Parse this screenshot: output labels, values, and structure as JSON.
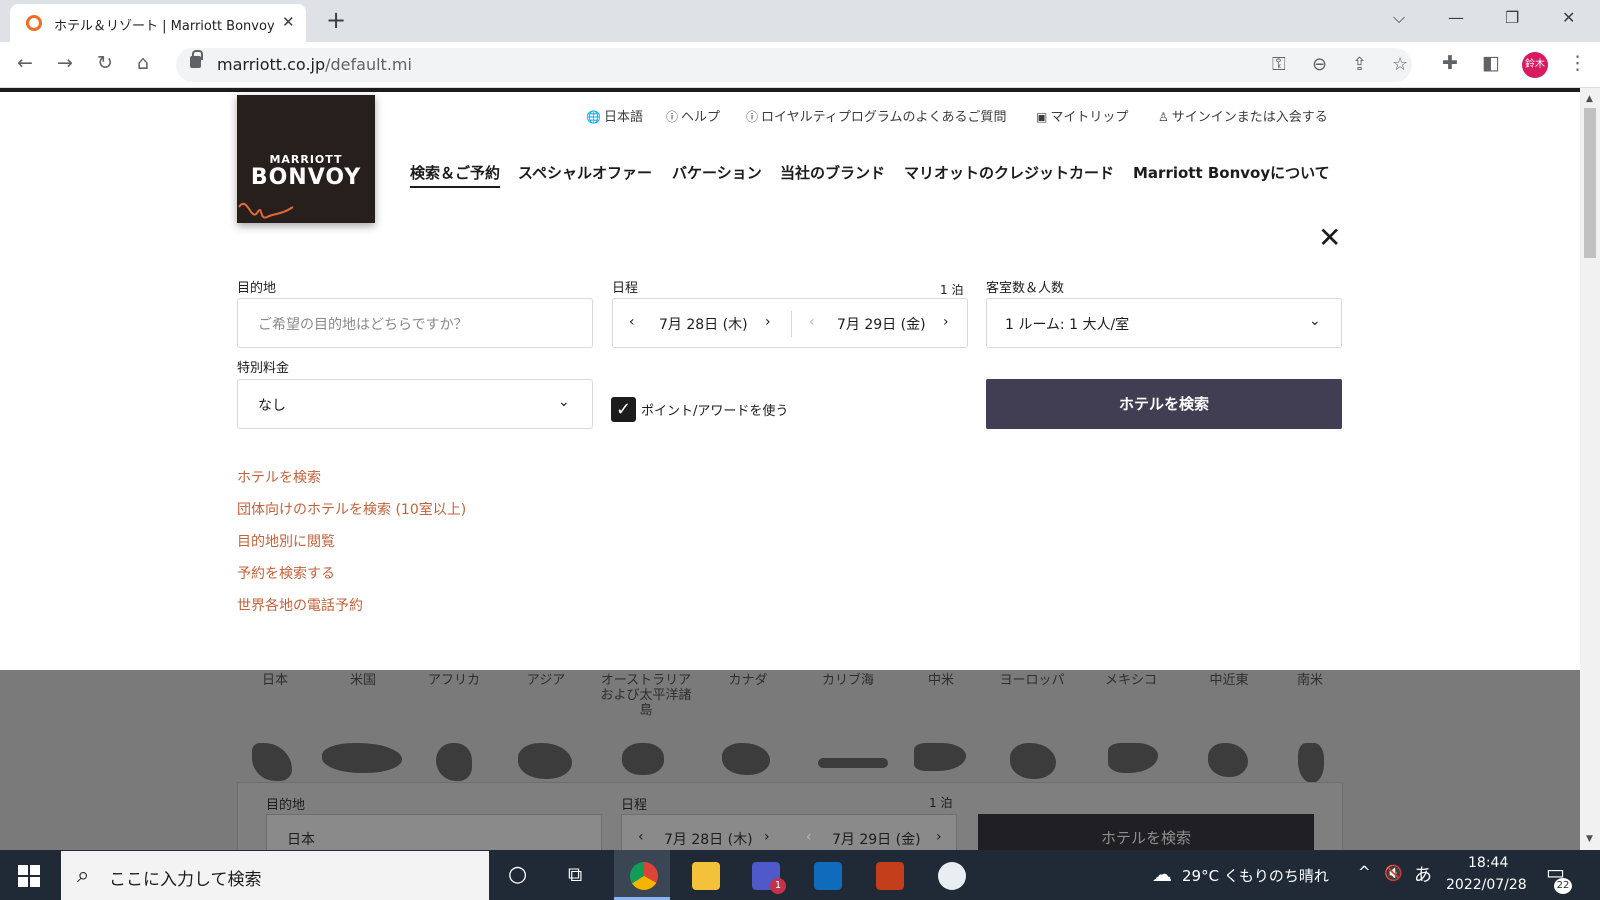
{
  "browser": {
    "tab_title": "ホテル＆リゾート | Marriott Bonvoy",
    "url_domain": "marriott.co.jp",
    "url_path": "/default.mi",
    "avatar": "鈴木"
  },
  "brand": {
    "line1": "MARRIOTT",
    "line2": "BONVOY"
  },
  "utility_nav": [
    {
      "label": "日本語",
      "icon": "globe-icon"
    },
    {
      "label": "ヘルプ",
      "icon": "help-icon"
    },
    {
      "label": "ロイヤルティプログラムのよくあるご質問",
      "icon": "info-icon"
    },
    {
      "label": "マイトリップ",
      "icon": "suitcase-icon"
    },
    {
      "label": "サインインまたは入会する",
      "icon": "user-icon"
    }
  ],
  "main_nav": [
    "検索＆ご予約",
    "スペシャルオファー",
    "バケーション",
    "当社のブランド",
    "マリオットのクレジットカード",
    "Marriott Bonvoyについて"
  ],
  "search": {
    "destination_label": "目的地",
    "destination_placeholder": "ご希望の目的地はどちらですか？",
    "dates_label": "日程",
    "nights": "1 泊",
    "checkin": "7月 28日 (木)",
    "checkout": "7月 29日 (金)",
    "rooms_label": "客室数＆人数",
    "rooms_value": "1 ルーム: 1 大人/室",
    "rate_label": "特別料金",
    "rate_value": "なし",
    "points_label": "ポイント/アワードを使う",
    "points_checked": true,
    "search_button": "ホテルを検索"
  },
  "links": [
    "ホテルを検索",
    "団体向けのホテルを検索 (10室以上)",
    "目的地別に閲覧",
    "予約を検索する",
    "世界各地の電話予約"
  ],
  "regions": [
    "日本",
    "米国",
    "アフリカ",
    "アジア",
    "オーストラリアおよび太平洋諸島",
    "カナダ",
    "カリブ海",
    "中米",
    "ヨーロッパ",
    "メキシコ",
    "中近東",
    "南米"
  ],
  "overlay_form": {
    "destination_label": "目的地",
    "destination_value": "日本",
    "dates_label": "日程",
    "nights": "1 泊",
    "checkin": "7月 28日 (木)",
    "checkout": "7月 29日 (金)",
    "search_button": "ホテルを検索"
  },
  "taskbar": {
    "search_placeholder": "ここに入力して検索",
    "weather": "29°C くもりのち晴れ",
    "ime": "あ",
    "time": "18:44",
    "date": "2022/07/28",
    "notifications": "22",
    "teams_badge": "1"
  },
  "colors": {
    "link": "#c4623a",
    "button": "#413d52",
    "brand_bg": "#271f1b",
    "taskbar": "#1f2a36"
  }
}
